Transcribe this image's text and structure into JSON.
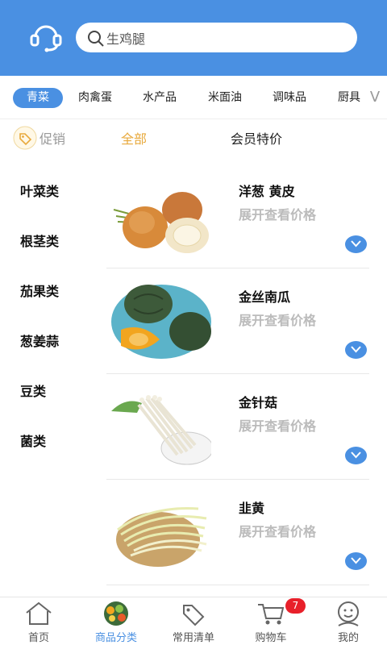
{
  "search": {
    "placeholder": "生鸡腿"
  },
  "category_tabs": [
    {
      "label": "青菜",
      "active": true
    },
    {
      "label": "肉禽蛋",
      "active": false
    },
    {
      "label": "水产品",
      "active": false
    },
    {
      "label": "米面油",
      "active": false
    },
    {
      "label": "调味品",
      "active": false
    },
    {
      "label": "厨具",
      "active": false
    }
  ],
  "tabs_more": "V",
  "filters": {
    "promo": "促销",
    "all": "全部",
    "member": "会员特价"
  },
  "sidebar": [
    "叶菜类",
    "根茎类",
    "茄果类",
    "葱姜蒜",
    "豆类",
    "菌类"
  ],
  "products": [
    {
      "name": "洋葱 黄皮",
      "price_hint": "展开查看价格"
    },
    {
      "name": "金丝南瓜",
      "price_hint": "展开查看价格"
    },
    {
      "name": "金针菇",
      "price_hint": "展开查看价格"
    },
    {
      "name": "韭黄",
      "price_hint": "展开查看价格"
    }
  ],
  "bottom_nav": [
    {
      "label": "首页",
      "icon": "home-icon",
      "active": false
    },
    {
      "label": "商品分类",
      "icon": "category-icon",
      "active": true
    },
    {
      "label": "常用清单",
      "icon": "tag-icon",
      "active": false
    },
    {
      "label": "购物车",
      "icon": "cart-icon",
      "active": false
    },
    {
      "label": "我的",
      "icon": "user-icon",
      "active": false
    }
  ],
  "cart_badge": "7",
  "colors": {
    "primary": "#4a90e2",
    "accent": "#e8a93c",
    "badge": "#e8202a"
  }
}
